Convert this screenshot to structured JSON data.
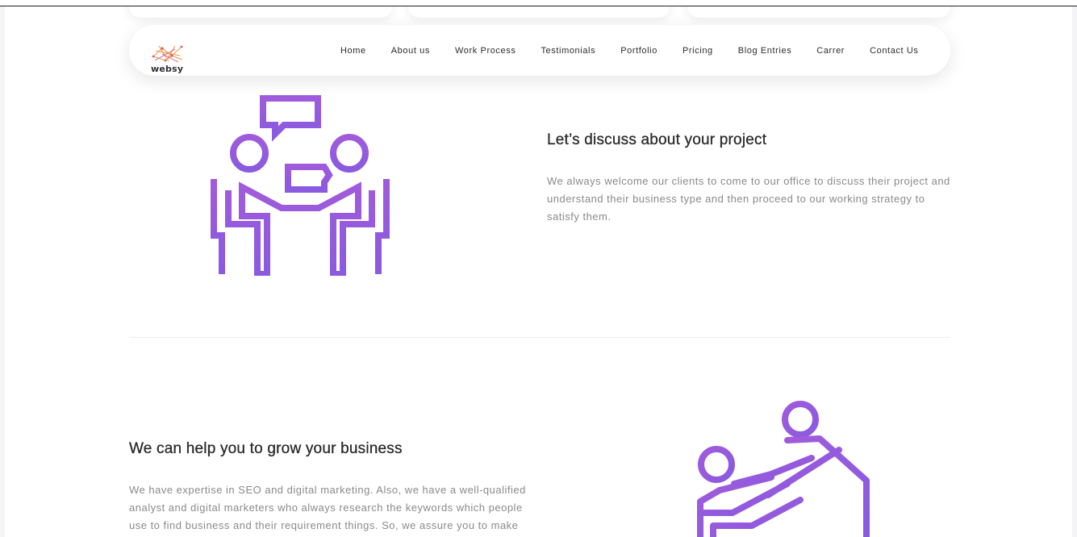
{
  "brand": {
    "name": "websy",
    "logo_icon": "network-logo-icon",
    "accent": "#9b5de5"
  },
  "nav": {
    "items": [
      {
        "label": "Home"
      },
      {
        "label": "About us"
      },
      {
        "label": "Work Process"
      },
      {
        "label": "Testimonials"
      },
      {
        "label": "Portfolio"
      },
      {
        "label": "Pricing"
      },
      {
        "label": "Blog Entries"
      },
      {
        "label": "Carrer"
      },
      {
        "label": "Contact Us"
      }
    ]
  },
  "blocks": [
    {
      "title": "Let’s discuss about your project",
      "text": "We always welcome our clients to come to our office to discuss their project and understand their business type and then proceed to our working strategy to satisfy them.",
      "icon": "discussion-icon"
    },
    {
      "title": "We can help you to grow your business",
      "text": "We have expertise in SEO and digital marketing. Also, we have a well-qualified analyst and digital marketers who always research the keywords which people use to find business and their requirement things. So, we assure you to make",
      "icon": "helping-hand-icon"
    }
  ]
}
